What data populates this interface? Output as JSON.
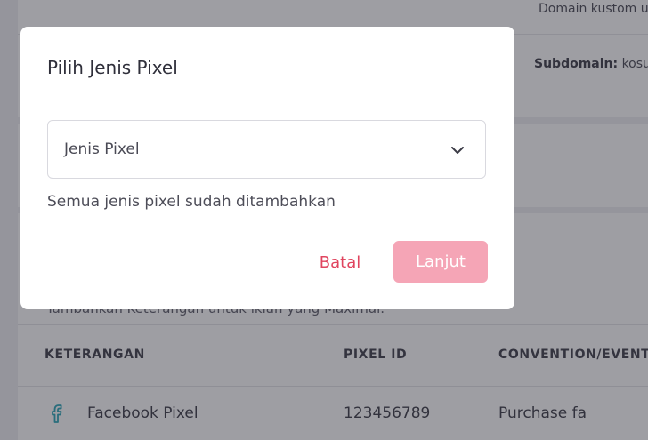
{
  "background": {
    "domain_note": "Domain kustom u",
    "subdomain_label": "Subdomain:",
    "subdomain_value": "kosu",
    "tambah_keterangan": "Tambahkan Keterangan untuk iklan yang Maximal.",
    "table": {
      "headers": [
        "KETERANGAN",
        "PIXEL ID",
        "CONVENTION/EVENT"
      ],
      "rows": [
        {
          "icon": "facebook-icon",
          "keterangan": "Facebook Pixel",
          "pixel_id": "123456789",
          "event": "Purchase fa"
        }
      ]
    }
  },
  "modal": {
    "title": "Pilih Jenis Pixel",
    "select": {
      "value": "Jenis Pixel",
      "icon": "chevron-down-icon"
    },
    "helper_text": "Semua jenis pixel sudah ditambahkan",
    "cancel_label": "Batal",
    "next_label": "Lanjut"
  },
  "colors": {
    "accent": "#e0455f",
    "button_disabled": "#f5a5b6",
    "facebook_icon": "#2aa6b8"
  }
}
